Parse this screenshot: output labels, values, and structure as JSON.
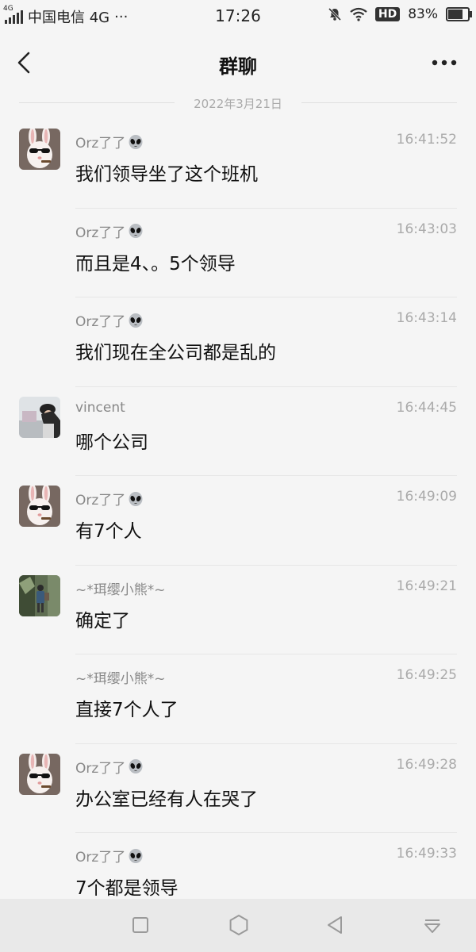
{
  "status_bar": {
    "network_small": "4G",
    "carrier": "中国电信 4G",
    "more": "···",
    "time": "17:26",
    "hd": "HD",
    "battery": "83%",
    "battery_level": 0.83
  },
  "header": {
    "title": "群聊"
  },
  "date_divider": "2022年3月21日",
  "messages": [
    {
      "sender": "Orz了了",
      "time": "16:41:52",
      "text": "我们领导坐了这个班机",
      "avatar": "bunny",
      "show_avatar": true
    },
    {
      "sender": "Orz了了",
      "time": "16:43:03",
      "text": "而且是4、。5个领导",
      "avatar": "bunny",
      "show_avatar": false
    },
    {
      "sender": "Orz了了",
      "time": "16:43:14",
      "text": "我们现在全公司都是乱的",
      "avatar": "bunny",
      "show_avatar": false
    },
    {
      "sender": "vincent",
      "time": "16:44:45",
      "text": "哪个公司",
      "avatar": "person",
      "show_avatar": true
    },
    {
      "sender": "Orz了了",
      "time": "16:49:09",
      "text": "有7个人",
      "avatar": "bunny",
      "show_avatar": true
    },
    {
      "sender": "~*珥缨小熊*~",
      "time": "16:49:21",
      "text": "确定了",
      "avatar": "outdoor",
      "show_avatar": true
    },
    {
      "sender": "~*珥缨小熊*~",
      "time": "16:49:25",
      "text": "直接7个人了",
      "avatar": "outdoor",
      "show_avatar": false
    },
    {
      "sender": "Orz了了",
      "time": "16:49:28",
      "text": "办公室已经有人在哭了",
      "avatar": "bunny",
      "show_avatar": true
    },
    {
      "sender": "Orz了了",
      "time": "16:49:33",
      "text": "7个都是领导",
      "avatar": "bunny",
      "show_avatar": false
    }
  ],
  "icons": {
    "back": "back-arrow-icon",
    "more": "more-dots-icon",
    "alien": "alien-emoji-icon",
    "nav_square": "square-icon",
    "nav_hexagon": "hexagon-icon",
    "nav_back": "triangle-back-icon",
    "nav_menu": "pull-down-icon"
  }
}
